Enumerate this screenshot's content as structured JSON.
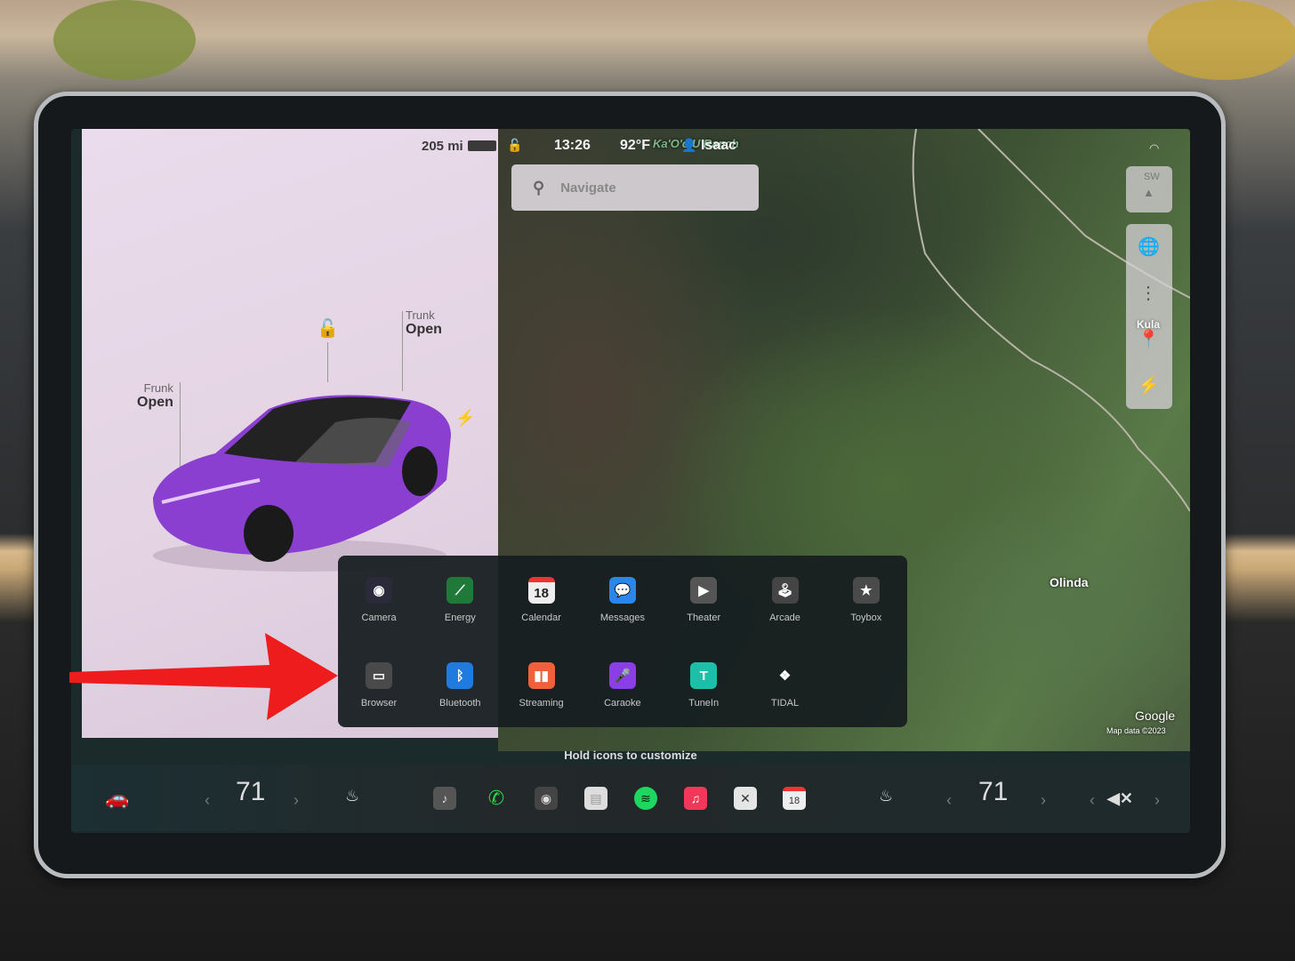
{
  "vehicle": {
    "range": "205 mi",
    "lock_state": "unlocked",
    "frunk": {
      "label": "Frunk",
      "state": "Open"
    },
    "trunk": {
      "label": "Trunk",
      "state": "Open"
    },
    "paint_color": "#8a3fd0"
  },
  "status": {
    "time": "13:26",
    "temperature": "92°F",
    "user": "Isaac"
  },
  "search": {
    "placeholder": "Navigate"
  },
  "map": {
    "labels": {
      "ranch": "Ka'O'o'U Ranch",
      "olinda": "Olinda",
      "kula": "Kula"
    },
    "compass": "SW",
    "attribution": "Google",
    "copyright": "Map data ©2023"
  },
  "launcher": {
    "apps": [
      {
        "label": "Camera",
        "icon": "camera-icon",
        "color": "#2a2a3a"
      },
      {
        "label": "Energy",
        "icon": "energy-chart-icon",
        "color": "#1f7a3a"
      },
      {
        "label": "Calendar",
        "icon": "calendar-icon",
        "color": "#eeeeee",
        "text": "18"
      },
      {
        "label": "Messages",
        "icon": "messages-icon",
        "color": "#2a86e8"
      },
      {
        "label": "Theater",
        "icon": "theater-icon",
        "color": "#555555"
      },
      {
        "label": "Arcade",
        "icon": "joystick-icon",
        "color": "#444444"
      },
      {
        "label": "Toybox",
        "icon": "toybox-icon",
        "color": "#4a4a4a"
      },
      {
        "label": "Browser",
        "icon": "browser-icon",
        "color": "#4a4a4a"
      },
      {
        "label": "Bluetooth",
        "icon": "bluetooth-icon",
        "color": "#1f7be0"
      },
      {
        "label": "Streaming",
        "icon": "streaming-icon",
        "color": "#f0603a"
      },
      {
        "label": "Caraoke",
        "icon": "microphone-icon",
        "color": "#8a3ee8"
      },
      {
        "label": "TuneIn",
        "icon": "tunein-icon",
        "color": "#1cc0a8"
      },
      {
        "label": "TIDAL",
        "icon": "tidal-icon",
        "color": "transparent"
      }
    ]
  },
  "hint": "Hold icons to customize",
  "dock": {
    "driver_temp": "71",
    "passenger_temp": "71",
    "calendar_day": "18",
    "volume": "muted"
  }
}
